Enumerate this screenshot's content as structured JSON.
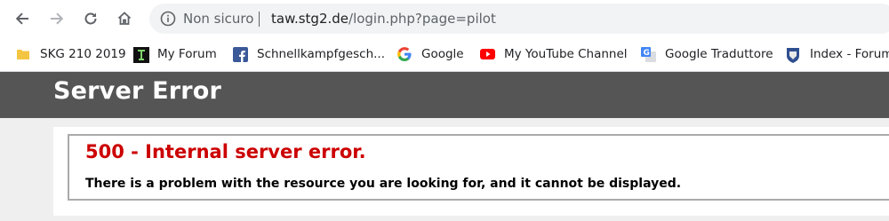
{
  "browser": {
    "security_label": "Non sicuro",
    "url_host": "taw.stg2.de",
    "url_rest": "/login.php?page=pilot",
    "icons": [
      "back-icon",
      "forward-icon",
      "reload-icon",
      "home-icon",
      "info-icon"
    ]
  },
  "bookmarks": [
    {
      "label": "SKG 210 2019",
      "icon": "folder-icon"
    },
    {
      "label": "My Forum",
      "icon": "forum-favicon"
    },
    {
      "label": "Schnellkampfgesch...",
      "icon": "facebook-icon"
    },
    {
      "label": "Google",
      "icon": "google-icon"
    },
    {
      "label": "My YouTube Channel",
      "icon": "youtube-icon"
    },
    {
      "label": "Google Traduttore",
      "icon": "google-translate-icon"
    },
    {
      "label": "Index - Forum",
      "icon": "forum-index-icon"
    }
  ],
  "page": {
    "title": "Server Error",
    "error_heading": "500 - Internal server error.",
    "error_message": "There is a problem with the resource you are looking for, and it cannot be displayed."
  },
  "colors": {
    "header_bg": "#555555",
    "error_red": "#cc0000",
    "page_bg": "#efefef"
  }
}
